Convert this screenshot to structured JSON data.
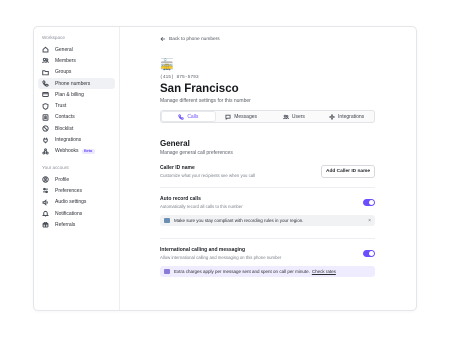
{
  "sidebar": {
    "workspace_title": "Workspace",
    "workspace_items": [
      {
        "label": "General",
        "icon": "home-icon"
      },
      {
        "label": "Members",
        "icon": "members-icon"
      },
      {
        "label": "Groups",
        "icon": "folder-icon"
      },
      {
        "label": "Phone numbers",
        "icon": "phone-icon",
        "active": true
      },
      {
        "label": "Plan & billing",
        "icon": "card-icon"
      },
      {
        "label": "Trust",
        "icon": "shield-icon"
      },
      {
        "label": "Contacts",
        "icon": "contacts-icon"
      },
      {
        "label": "Blocklist",
        "icon": "block-icon"
      },
      {
        "label": "Integrations",
        "icon": "plug-icon"
      },
      {
        "label": "Webhooks",
        "icon": "webhook-icon",
        "badge": "Beta"
      }
    ],
    "account_title": "Your account",
    "account_items": [
      {
        "label": "Profile",
        "icon": "user-icon"
      },
      {
        "label": "Preferences",
        "icon": "sliders-icon"
      },
      {
        "label": "Audio settings",
        "icon": "audio-icon"
      },
      {
        "label": "Notifications",
        "icon": "bell-icon"
      },
      {
        "label": "Referrals",
        "icon": "gift-icon"
      }
    ]
  },
  "main": {
    "back_label": "Back to phone numbers",
    "emoji": "🚋",
    "phone_number": "(415) 875-5793",
    "title": "San Francisco",
    "subtitle": "Manage different settings for this number",
    "tabs": [
      {
        "label": "Calls",
        "icon": "phone-icon",
        "active": true
      },
      {
        "label": "Messages",
        "icon": "message-icon"
      },
      {
        "label": "Users",
        "icon": "users-icon"
      },
      {
        "label": "Integrations",
        "icon": "integrations-icon"
      }
    ],
    "section_title": "General",
    "section_subtitle": "Manage general call preferences",
    "caller_id": {
      "label": "Caller ID name",
      "description": "Customize what your recipients see when you call",
      "button": "Add Caller ID name"
    },
    "auto_record": {
      "label": "Auto record calls",
      "description": "Automatically record all calls to this number",
      "enabled": true,
      "notice": "Make sure you stay compliant with recording rules in your region.",
      "notice_close": "×"
    },
    "international": {
      "label": "International calling and messaging",
      "description": "Allow international calling and messaging on this phone number",
      "enabled": true,
      "notice": "Extra charges apply per message sent and spent on call per minute.",
      "notice_link": "Check rates"
    }
  },
  "colors": {
    "accent": "#6b4eff",
    "notice_gray": "#f1f2f4",
    "notice_purple": "#f0ecff"
  }
}
